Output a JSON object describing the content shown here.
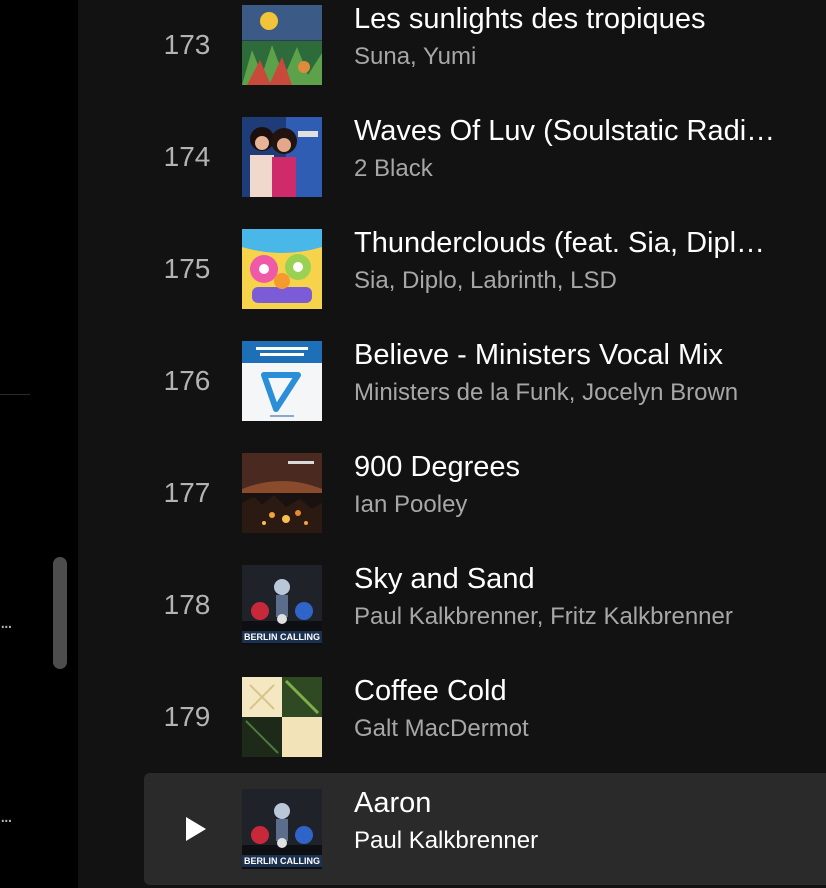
{
  "tracks": [
    {
      "number": "173",
      "title": "Les sunlights des tropiques",
      "artists": "Suna, Yumi",
      "art_icon": "album-cover-tropical"
    },
    {
      "number": "174",
      "title": "Waves Of Luv (Soulstatic Radi…",
      "artists": "2 Black",
      "art_icon": "album-cover-two-women"
    },
    {
      "number": "175",
      "title": "Thunderclouds (feat. Sia, Dipl…",
      "artists": "Sia, Diplo, Labrinth, LSD",
      "art_icon": "album-cover-psychedelic"
    },
    {
      "number": "176",
      "title": "Believe - Ministers Vocal Mix",
      "artists": "Ministers de la Funk, Jocelyn Brown",
      "art_icon": "album-cover-boomerang"
    },
    {
      "number": "177",
      "title": "900 Degrees",
      "artists": "Ian Pooley",
      "art_icon": "album-cover-night-city"
    },
    {
      "number": "178",
      "title": "Sky and Sand",
      "artists": "Paul Kalkbrenner, Fritz Kalkbrenner",
      "art_icon": "album-cover-berlin-calling",
      "art_text": "BERLIN CALLING"
    },
    {
      "number": "179",
      "title": "Coffee Cold",
      "artists": "Galt MacDermot",
      "art_icon": "album-cover-checker"
    },
    {
      "number": "",
      "title": "Aaron",
      "artists": "Paul Kalkbrenner",
      "art_icon": "album-cover-berlin-calling",
      "art_text": "BERLIN CALLING",
      "state": "hovered"
    }
  ],
  "colors": {
    "background": "#121212",
    "sidebar": "#000000",
    "row_hover": "#2a2a2a",
    "text_primary": "#ffffff",
    "text_secondary": "#a7a7a7"
  },
  "sidebar": {
    "ellipsis_1": "...",
    "ellipsis_2": "..."
  }
}
